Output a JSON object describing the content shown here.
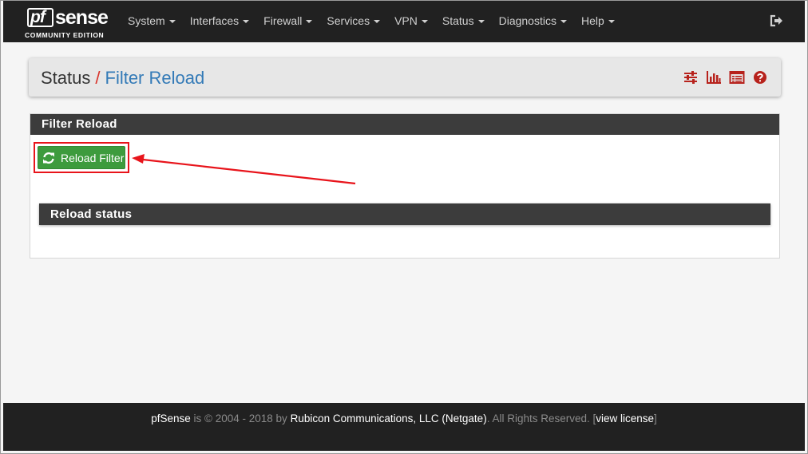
{
  "brand": {
    "mark": "pf",
    "name": "sense",
    "edition": "COMMUNITY EDITION"
  },
  "nav": {
    "items": [
      {
        "label": "System"
      },
      {
        "label": "Interfaces"
      },
      {
        "label": "Firewall"
      },
      {
        "label": "Services"
      },
      {
        "label": "VPN"
      },
      {
        "label": "Status"
      },
      {
        "label": "Diagnostics"
      },
      {
        "label": "Help"
      }
    ],
    "logout_icon": "sign-out-icon"
  },
  "breadcrumb": {
    "parent": "Status",
    "separator": "/",
    "current": "Filter Reload"
  },
  "header_icons": [
    "sliders-icon",
    "bar-chart-icon",
    "list-table-icon",
    "help-circle-icon"
  ],
  "panel": {
    "title": "Filter Reload",
    "reload_button": "Reload Filter",
    "reload_icon": "refresh-icon",
    "status_title": "Reload status"
  },
  "footer": {
    "product": "pfSense",
    "is": "is",
    "copyright": "© 2004 - 2018",
    "by": "by",
    "company": "Rubicon Communications, LLC (Netgate)",
    "rights": ". All Rights Reserved. [",
    "license_link": "view license",
    "close_bracket": "]"
  },
  "colors": {
    "navbar": "#212121",
    "accent_red": "#d9342b",
    "link_blue": "#337ab7",
    "button_green": "#3d9b3d",
    "highlight_red": "#e8141b"
  }
}
